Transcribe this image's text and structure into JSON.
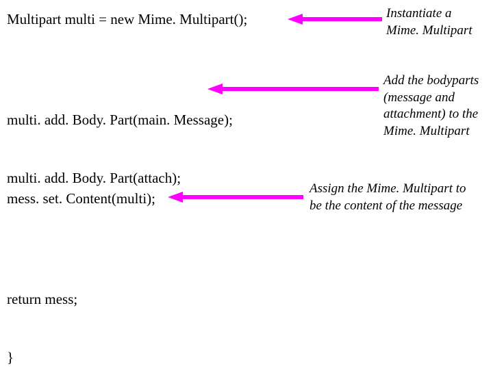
{
  "code": {
    "block1": "Multipart multi = new Mime. Multipart();",
    "block2_line1": "multi. add. Body. Part(main. Message);",
    "block2_line2": "multi. add. Body. Part(attach);",
    "block3": "mess. set. Content(multi);",
    "block4_line1": "return mess;",
    "block4_line2": "}"
  },
  "annot": {
    "a1_line1": "Instantiate a",
    "a1_line2": "Mime. Multipart",
    "a2_line1": "Add the bodyparts",
    "a2_line2": "(message and",
    "a2_line3": "attachment) to the",
    "a2_line4": "Mime. Multipart",
    "a3_line1": "Assign the Mime. Multipart to",
    "a3_line2": "be the content of the message"
  },
  "colors": {
    "arrow": "#ff00ff",
    "text": "#000000"
  }
}
